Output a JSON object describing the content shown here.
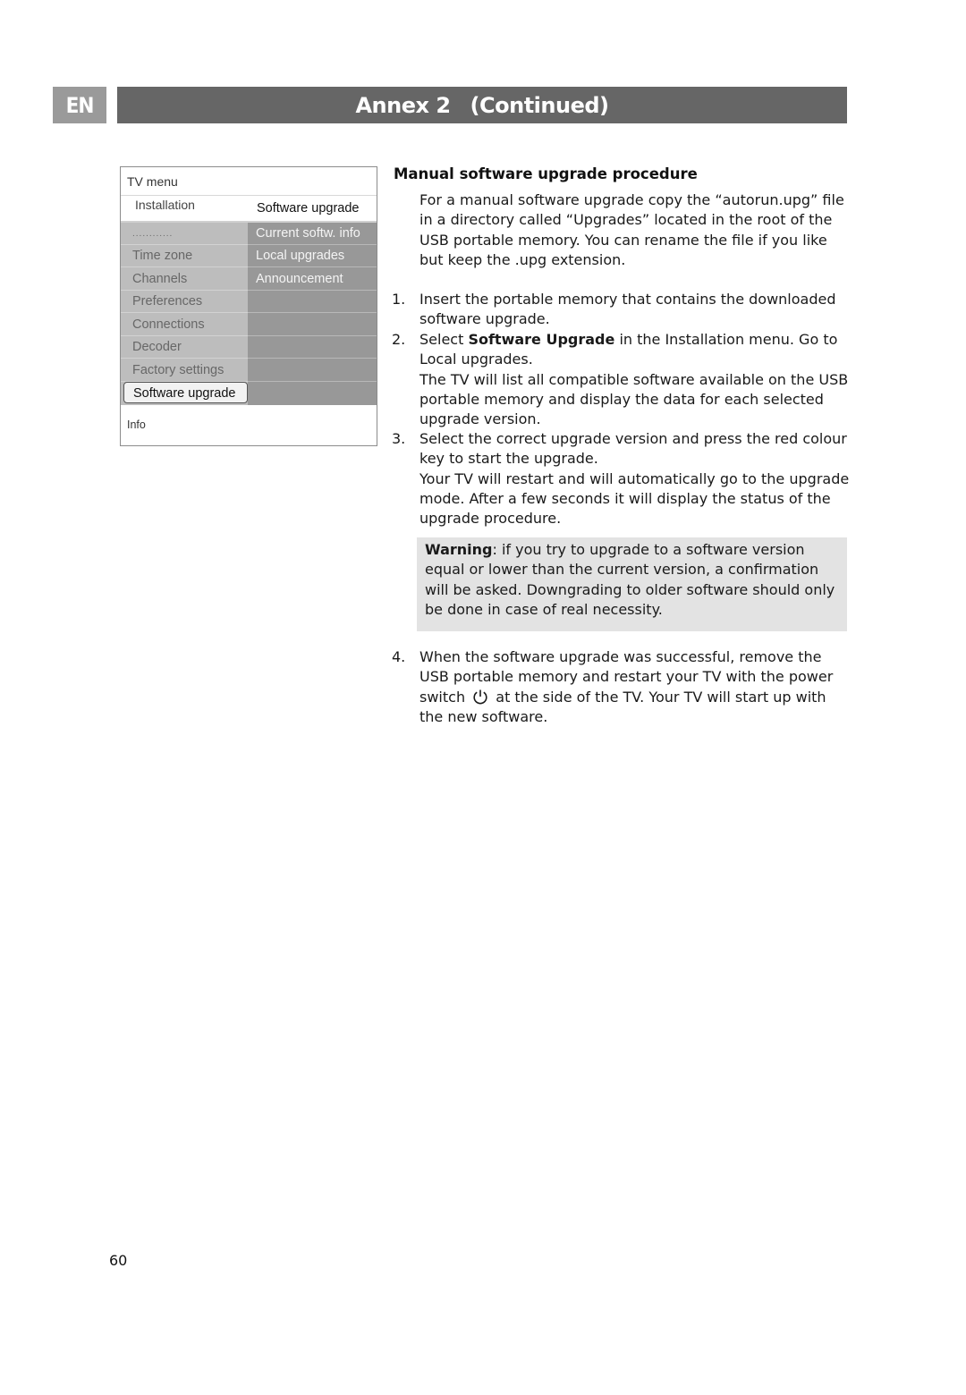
{
  "header": {
    "language_tab": "EN",
    "title_main": "Annex 2",
    "title_suffix": "(Continued)"
  },
  "tv_menu": {
    "title": "TV menu",
    "breadcrumb_left": "Installation",
    "breadcrumb_right": "Software upgrade",
    "left_items": [
      {
        "label": "............"
      },
      {
        "label": "Time zone"
      },
      {
        "label": "Channels"
      },
      {
        "label": "Preferences"
      },
      {
        "label": "Connections"
      },
      {
        "label": "Decoder"
      },
      {
        "label": "Factory settings"
      }
    ],
    "selected_item": "Software upgrade",
    "right_items": [
      {
        "label": "Current softw. info"
      },
      {
        "label": "Local upgrades"
      },
      {
        "label": "Announcement"
      }
    ],
    "info_label": "Info"
  },
  "content": {
    "heading": "Manual software upgrade procedure",
    "intro": "For a manual software upgrade copy the “autorun.upg” file in a directory called “Upgrades” located in the root of the USB portable memory. You can rename the file if you like but keep the .upg extension.",
    "steps": [
      {
        "number": "1.",
        "text": "Insert the portable memory that contains the downloaded software upgrade."
      },
      {
        "number": "2.",
        "prefix": "Select ",
        "bold": "Software Upgrade",
        "suffix": " in the Installation menu. Go to Local upgrades.",
        "note": "The TV will list all compatible software available on the USB portable memory and display the data for each selected upgrade version."
      },
      {
        "number": "3.",
        "text": "Select the correct upgrade version and press the red colour key to start the upgrade.",
        "note": "Your TV will restart and will automatically go to the upgrade mode. After a few seconds it will display the status of the upgrade procedure."
      },
      {
        "number": "4.",
        "text_before_icon": "When the software upgrade was successful, remove the USB portable memory and restart your TV with the power switch",
        "icon": "power-icon",
        "text_after_icon": "at the side of the TV. Your TV will start up with the new software."
      }
    ],
    "warning": {
      "label": "Warning",
      "text": ": if you try to upgrade to a software version equal or lower than the current version, a confirmation will be asked. Downgrading to older software should only be done in case of real necessity."
    }
  },
  "footer": {
    "page_number": "60"
  }
}
